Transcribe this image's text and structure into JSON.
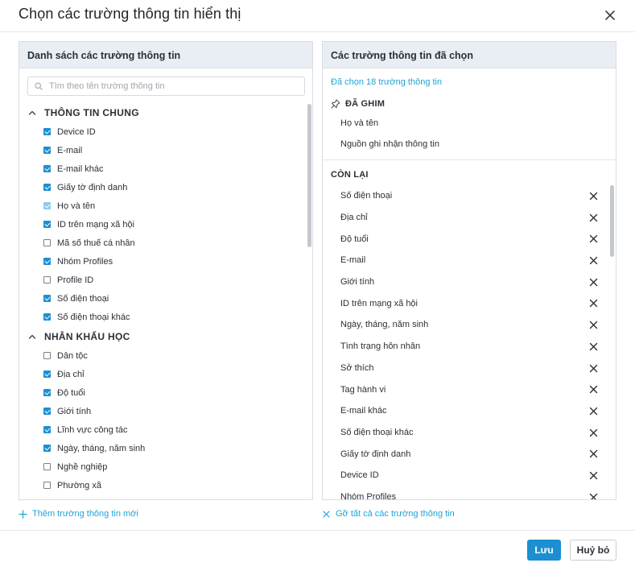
{
  "dialog": {
    "title": "Chọn các trường thông tin hiển thị",
    "close_icon": "close-icon"
  },
  "left_panel": {
    "header": "Danh sách các trường thông tin",
    "search_placeholder": "Tìm theo tên trường thông tin",
    "groups": [
      {
        "title": "THÔNG TIN CHUNG",
        "items": [
          {
            "label": "Device ID",
            "checked": true,
            "disabled": false
          },
          {
            "label": "E-mail",
            "checked": true,
            "disabled": false
          },
          {
            "label": "E-mail khác",
            "checked": true,
            "disabled": false
          },
          {
            "label": "Giấy tờ định danh",
            "checked": true,
            "disabled": false
          },
          {
            "label": "Họ và tên",
            "checked": true,
            "disabled": true
          },
          {
            "label": "ID trên mạng xã hội",
            "checked": true,
            "disabled": false
          },
          {
            "label": "Mã số thuế cá nhân",
            "checked": false,
            "disabled": false
          },
          {
            "label": "Nhóm Profiles",
            "checked": true,
            "disabled": false
          },
          {
            "label": "Profile ID",
            "checked": false,
            "disabled": false
          },
          {
            "label": "Số điện thoại",
            "checked": true,
            "disabled": false
          },
          {
            "label": "Số điện thoại khác",
            "checked": true,
            "disabled": false
          }
        ]
      },
      {
        "title": "NHÂN KHẨU HỌC",
        "items": [
          {
            "label": "Dân tộc",
            "checked": false,
            "disabled": false
          },
          {
            "label": "Địa chỉ",
            "checked": true,
            "disabled": false
          },
          {
            "label": "Độ tuổi",
            "checked": true,
            "disabled": false
          },
          {
            "label": "Giới tính",
            "checked": true,
            "disabled": false
          },
          {
            "label": "Lĩnh vực công tác",
            "checked": true,
            "disabled": false
          },
          {
            "label": "Ngày, tháng, năm sinh",
            "checked": true,
            "disabled": false
          },
          {
            "label": "Nghề nghiệp",
            "checked": false,
            "disabled": false
          },
          {
            "label": "Phường xã",
            "checked": false,
            "disabled": false
          }
        ]
      }
    ],
    "add_link": "Thêm trường thông tin mới"
  },
  "right_panel": {
    "header": "Các trường thông tin đã chọn",
    "selected_count": "Đã chọn 18 trường thông tin",
    "pinned_title": "ĐÃ GHIM",
    "pinned": [
      "Họ và tên",
      "Nguồn ghi nhận thông tin"
    ],
    "remaining_title": "CÒN LẠI",
    "remaining": [
      "Số điện thoại",
      "Địa chỉ",
      "Độ tuổi",
      "E-mail",
      "Giới tính",
      "ID trên mạng xã hội",
      "Ngày, tháng, năm sinh",
      "Tình trạng hôn nhân",
      "Sở thích",
      "Tag hành vi",
      "E-mail khác",
      "Số điện thoại khác",
      "Giấy tờ định danh",
      "Device ID",
      "Nhóm Profiles"
    ],
    "clear_link": "Gỡ tất cả các trường thông tin"
  },
  "footer": {
    "save_label": "Lưu",
    "cancel_label": "Huỷ bỏ"
  },
  "colors": {
    "accent": "#1b8fd1",
    "link": "#1fa4d8",
    "panel_header_bg": "#e9eef5"
  }
}
